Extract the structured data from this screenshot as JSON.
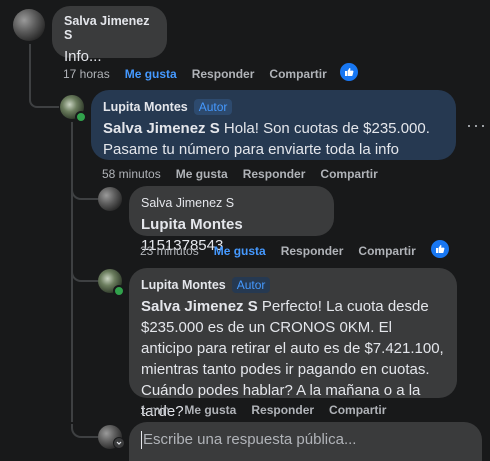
{
  "comment1": {
    "author": "Salva Jimenez S",
    "text": "Info...",
    "time": "17 horas",
    "like": "Me gusta",
    "reply": "Responder",
    "share": "Compartir"
  },
  "reply1": {
    "author": "Lupita Montes",
    "badge": "Autor",
    "mention": "Salva Jimenez S",
    "text": " Hola! Son cuotas de $235.000. Pasame tu número para enviarte toda la info",
    "time": "58 minutos",
    "like": "Me gusta",
    "reply": "Responder",
    "share": "Compartir"
  },
  "reply2": {
    "author": "Salva Jimenez S",
    "mention": "Lupita Montes",
    "text": " 1151378543",
    "time": "23 minutos",
    "like": "Me gusta",
    "reply": "Responder",
    "share": "Compartir"
  },
  "reply3": {
    "author": "Lupita Montes",
    "badge": "Autor",
    "mention": "Salva Jimenez S",
    "text": " Perfecto! La cuota desde $235.000 es de un CRONOS 0KM. El anticipo para retirar el auto es de $7.421.100, mientras tanto podes ir pagando en cuotas. Cuándo podes hablar? A la mañana o a la tarde?",
    "time": "1 min",
    "like": "Me gusta",
    "reply": "Responder",
    "share": "Compartir"
  },
  "composer": {
    "placeholder": "Escribe una respuesta pública..."
  },
  "colors": {
    "background": "#18191a",
    "bubble": "#3a3b3c",
    "highlight_bubble": "#263951",
    "accent": "#4599ff",
    "like_blue": "#1877f2"
  }
}
